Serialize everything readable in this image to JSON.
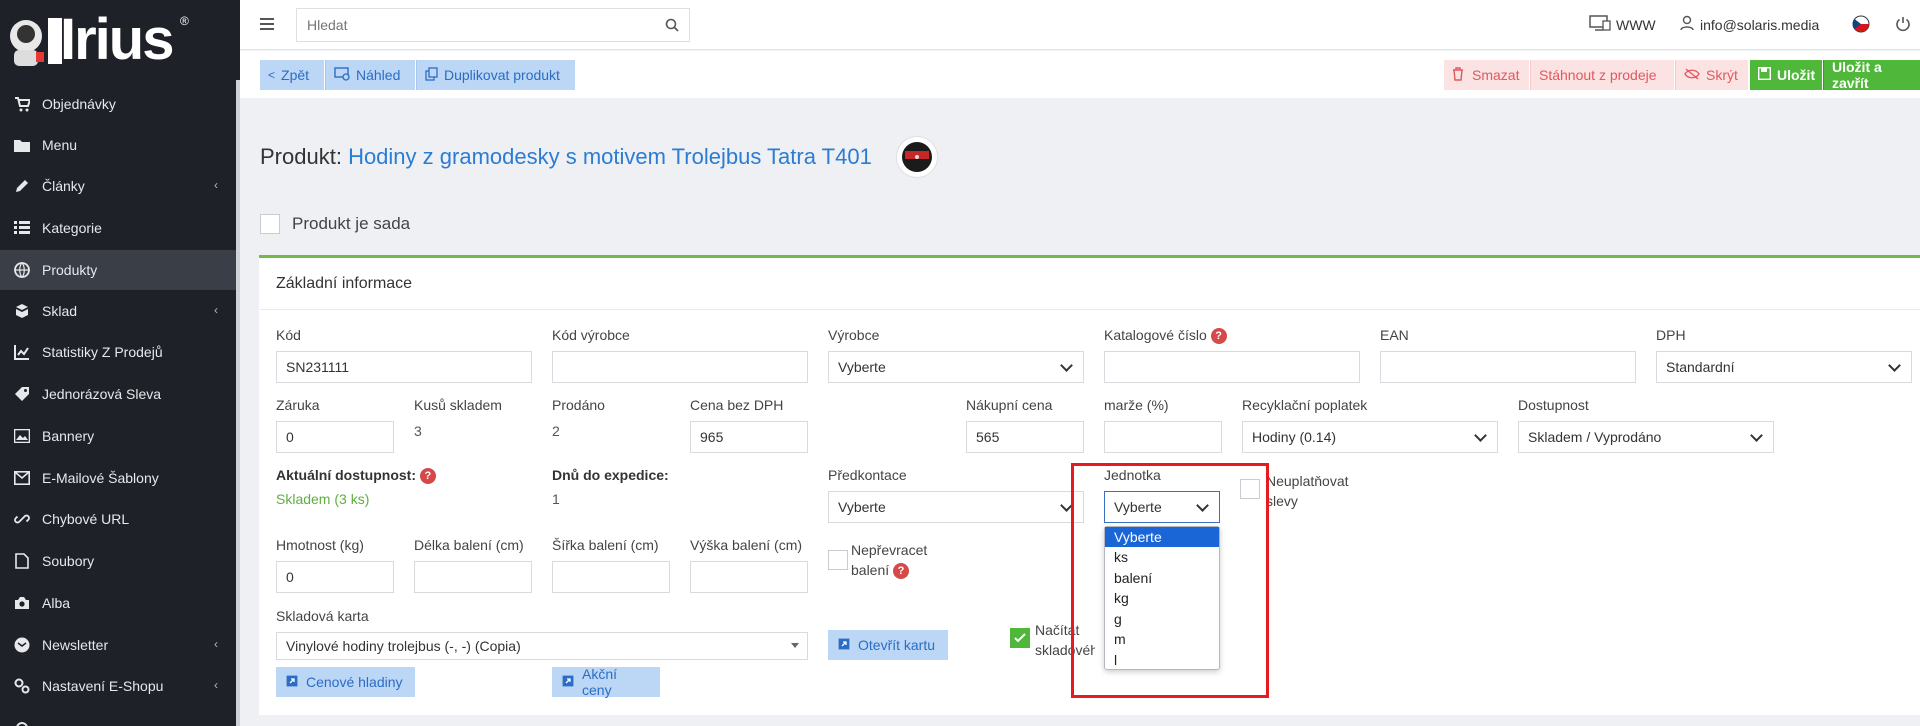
{
  "logo": {
    "text": "Irius",
    "mark": "®"
  },
  "sidebar": {
    "items": [
      {
        "label": "Objednávky",
        "icon": "cart-icon"
      },
      {
        "label": "Menu",
        "icon": "folder-icon"
      },
      {
        "label": "Články",
        "icon": "pencil-icon"
      },
      {
        "label": "Kategorie",
        "icon": "list-icon"
      },
      {
        "label": "Produkty",
        "icon": "globe-icon"
      },
      {
        "label": "Sklad",
        "icon": "boxes-icon"
      },
      {
        "label": "Statistiky Z Prodejů",
        "icon": "chart-icon"
      },
      {
        "label": "Jednorázová Sleva",
        "icon": "tag-icon"
      },
      {
        "label": "Bannery",
        "icon": "image-icon"
      },
      {
        "label": "E-Mailové Šablony",
        "icon": "mail-icon"
      },
      {
        "label": "Chybové URL",
        "icon": "link-icon"
      },
      {
        "label": "Soubory",
        "icon": "file-icon"
      },
      {
        "label": "Alba",
        "icon": "camera-icon"
      },
      {
        "label": "Newsletter",
        "icon": "newsletter-icon"
      },
      {
        "label": "Nastavení E-Shopu",
        "icon": "cogs-icon"
      }
    ],
    "chevron": "‹"
  },
  "topbar": {
    "search_placeholder": "Hledat",
    "www_label": "WWW",
    "user_email": "info@solaris.media"
  },
  "toolbar": {
    "back": "Zpět",
    "preview": "Náhled",
    "duplicate": "Duplikovat produkt",
    "delete": "Smazat",
    "withdraw": "Stáhnout z prodeje",
    "hide": "Skrýt",
    "save": "Uložit",
    "save_close": "Uložit a zavřít"
  },
  "page": {
    "title_prefix": "Produkt:",
    "title_product": "Hodiny z gramodesky s motivem Trolejbus Tatra T401",
    "is_set_label": "Produkt je sada"
  },
  "card": {
    "header": "Základní informace",
    "kod_label": "Kód",
    "kod_value": "SN231111",
    "kod_vyrobce_label": "Kód výrobce",
    "vyrobce_label": "Výrobce",
    "vyrobce_value": "Vyberte",
    "katalog_label": "Katalogové číslo",
    "ean_label": "EAN",
    "dph_label": "DPH",
    "dph_value": "Standardní",
    "zaruka_label": "Záruka",
    "zaruka_value": "0",
    "kusu_label": "Kusů skladem",
    "kusu_value": "3",
    "prodano_label": "Prodáno",
    "prodano_value": "2",
    "cena_label": "Cena bez DPH",
    "cena_value": "965",
    "nakupni_label": "Nákupní cena",
    "nakupni_value": "565",
    "marze_label": "marže (%)",
    "recykl_label": "Recyklační poplatek",
    "recykl_value": "Hodiny (0.14)",
    "dostupnost_label": "Dostupnost",
    "dostupnost_value": "Skladem / Vyprodáno",
    "aktualni_label": "Aktuální dostupnost:",
    "aktualni_value": "Skladem (3 ks)",
    "dnu_label": "Dnů do expedice:",
    "dnu_value": "1",
    "predkontace_label": "Předkontace",
    "predkontace_value": "Vyberte",
    "jednotka_label": "Jednotka",
    "jednotka_value": "Vyberte",
    "neuplatnovat_label": "Neuplatňovat slevy",
    "hmotnost_label": "Hmotnost (kg)",
    "hmotnost_value": "0",
    "delka_label": "Délka balení (cm)",
    "sirka_label": "Šířka balení (cm)",
    "vyska_label": "Výška balení (cm)",
    "neprevracet_label": "Nepřevracet balení",
    "skladova_label": "Skladová karta",
    "skladova_value": "Vinylové hodiny trolejbus (-, -) (Copia)",
    "otevrit_label": "Otevřít kartu",
    "nacitat_label": "Načítat skladového",
    "cenove_label": "Cenové hladiny",
    "akcni_label": "Akční ceny",
    "help_mark": "?"
  },
  "unit_dropdown": {
    "options": [
      "Vyberte",
      "ks",
      "balení",
      "kg",
      "g",
      "m",
      "l"
    ],
    "selected": "Vyberte"
  },
  "colors": {
    "accent": "#2b7cd3",
    "highlight": "#e8191f",
    "success": "#4fb83b"
  }
}
